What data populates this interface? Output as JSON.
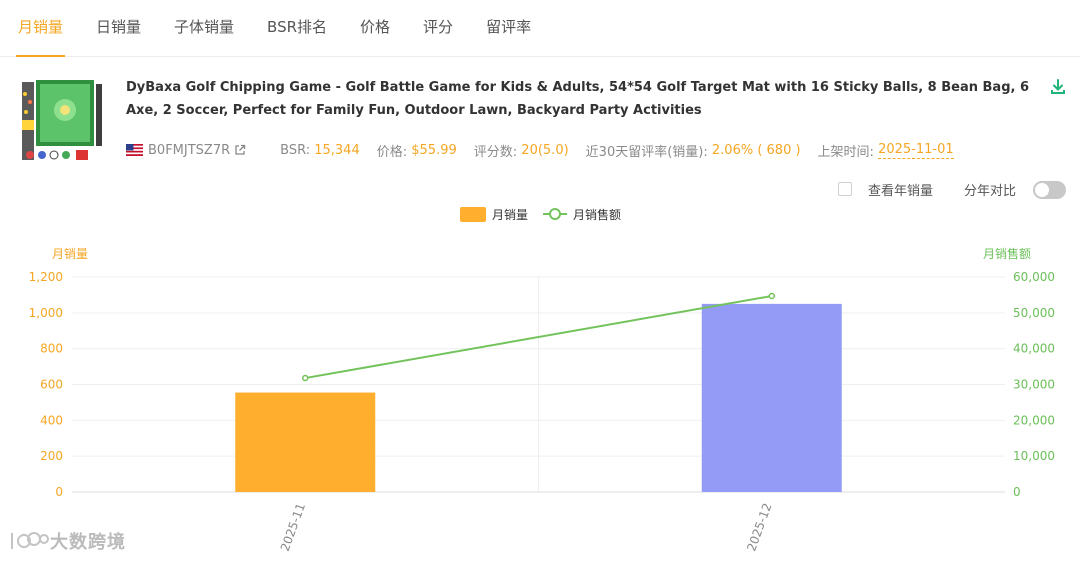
{
  "tabs": [
    {
      "label": "月销量",
      "active": true
    },
    {
      "label": "日销量",
      "active": false
    },
    {
      "label": "子体销量",
      "active": false
    },
    {
      "label": "BSR排名",
      "active": false
    },
    {
      "label": "价格",
      "active": false
    },
    {
      "label": "评分",
      "active": false
    },
    {
      "label": "留评率",
      "active": false
    }
  ],
  "product": {
    "title": "DyBaxa Golf Chipping Game - Golf Battle Game for Kids & Adults, 54*54 Golf Target Mat with 16 Sticky Balls, 8 Bean Bag, 6 Axe, 2 Soccer, Perfect for Family Fun, Outdoor Lawn, Backyard Party Activities",
    "asin": "B0FMJTSZ7R",
    "bsr_label": "BSR:",
    "bsr_value": "15,344",
    "price_label": "价格:",
    "price_value": "$55.99",
    "rating_label": "评分数:",
    "rating_value": "20(5.0)",
    "review_rate_label": "近30天留评率(销量):",
    "review_rate_value": "2.06% ( 680 )",
    "listed_label": "上架时间:",
    "listed_value": "2025-11-01"
  },
  "controls": {
    "yearly_label": "查看年销量",
    "compare_label": "分年对比"
  },
  "icons": {
    "flag": "us-flag-icon",
    "external": "external-link-icon",
    "download": "download-icon"
  },
  "colors": {
    "accent": "#f5a623",
    "bar_1": "#ffae2e",
    "bar_2": "#939bf7",
    "line": "#73c35c",
    "left_axis": "#f5a623",
    "right_axis": "#6cc05a"
  },
  "watermark": "大数跨境",
  "chart_data": {
    "type": "bar",
    "categories": [
      "2025-11",
      "2025-12"
    ],
    "series": [
      {
        "name": "月销量",
        "type": "bar",
        "axis": "left",
        "values": [
          555,
          1050
        ]
      },
      {
        "name": "月销售额",
        "type": "line",
        "axis": "right",
        "values": [
          31800,
          54700
        ]
      }
    ],
    "left_axis": {
      "label": "月销量",
      "ylim": [
        0,
        1200
      ],
      "ticks": [
        "0",
        "200",
        "400",
        "600",
        "800",
        "1,000",
        "1,200"
      ]
    },
    "right_axis": {
      "label": "月销售额",
      "ylim": [
        0,
        60000
      ],
      "ticks": [
        "0",
        "10,000",
        "20,000",
        "30,000",
        "40,000",
        "50,000",
        "60,000"
      ]
    },
    "legend": "top-center",
    "grid": true
  }
}
